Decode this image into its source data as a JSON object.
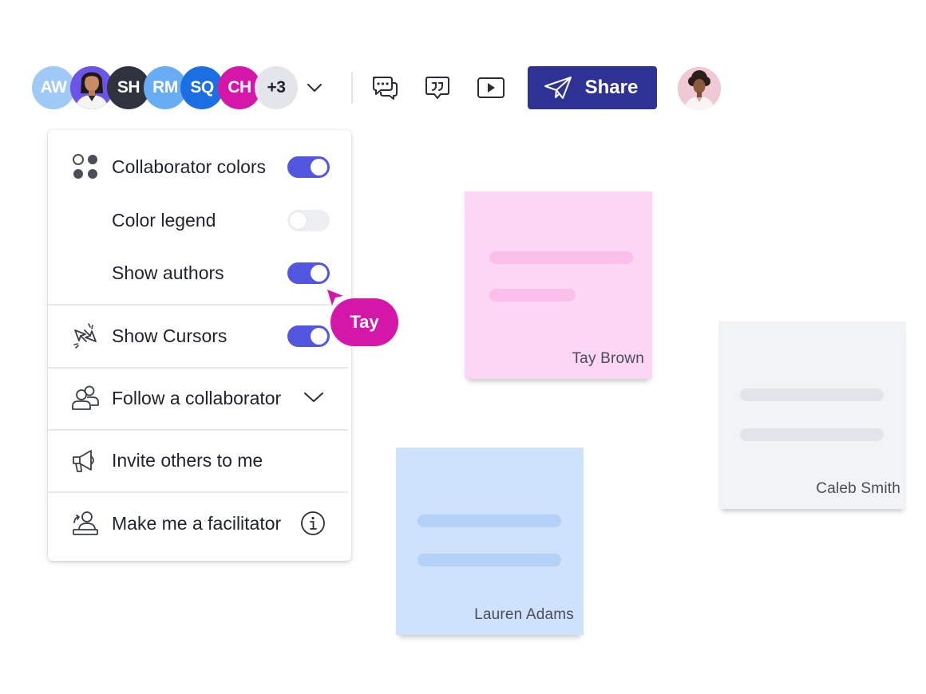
{
  "toolbar": {
    "collaborators": [
      {
        "initials": "AW",
        "color": "#9fcaf6",
        "type": "initials"
      },
      {
        "initials": "",
        "color": "#6a55e8",
        "type": "photo"
      },
      {
        "initials": "SH",
        "color": "#2e333d",
        "type": "initials"
      },
      {
        "initials": "RM",
        "color": "#68adf4",
        "type": "initials"
      },
      {
        "initials": "SQ",
        "color": "#1c6fe2",
        "type": "initials"
      },
      {
        "initials": "CH",
        "color": "#d417a9",
        "type": "initials"
      },
      {
        "initials": "+3",
        "color": "#e3e5ea",
        "type": "overflow"
      }
    ],
    "share_label": "Share",
    "share_color": "#2d3294"
  },
  "menu": {
    "collaborator_colors": {
      "label": "Collaborator colors",
      "enabled": true
    },
    "color_legend": {
      "label": "Color legend",
      "enabled": false
    },
    "show_authors": {
      "label": "Show authors",
      "enabled": true
    },
    "show_cursors": {
      "label": "Show Cursors",
      "enabled": true
    },
    "follow": {
      "label": "Follow a collaborator"
    },
    "invite": {
      "label": "Invite others to me"
    },
    "facilitator": {
      "label": "Make me a facilitator"
    },
    "accent": "#5356de"
  },
  "cursor": {
    "name": "Tay",
    "color": "#d417a9"
  },
  "notes": [
    {
      "author": "Tay Brown",
      "color": "#fcd6f4",
      "line_color": "#f9c0ec"
    },
    {
      "author": "Caleb Smith",
      "color": "#f2f3f5",
      "line_color": "#e3e4e9"
    },
    {
      "author": "Lauren Adams",
      "color": "#cfe2fc",
      "line_color": "#b4d2f8"
    }
  ]
}
